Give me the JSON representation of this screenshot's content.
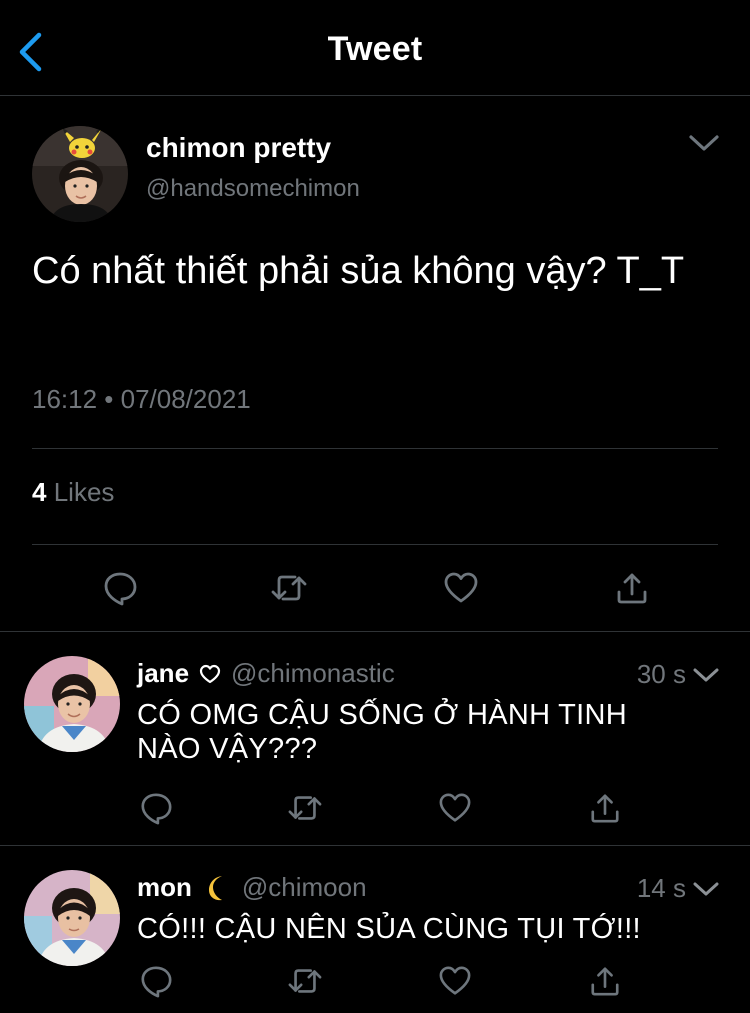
{
  "header": {
    "title": "Tweet"
  },
  "tweet": {
    "author_name": "chimon pretty",
    "author_handle": "@handsomechimon",
    "text": "Có nhất thiết phải sủa không vậy? T_T",
    "timestamp": "16:12 • 07/08/2021",
    "likes_count": "4",
    "likes_label": "Likes"
  },
  "replies": [
    {
      "name": "jane",
      "name_glyph": "heart-outline-icon",
      "handle": "@chimonastic",
      "time": "30 s",
      "text": "CÓ OMG CẬU SỐNG Ở HÀNH TINH NÀO VẬY???"
    },
    {
      "name": "mon",
      "name_glyph": "crescent-moon-emoji",
      "handle": "@chimoon",
      "time": "14 s",
      "text": "CÓ!!! CẬU NÊN SỦA CÙNG TỤI TỚ!!!"
    }
  ],
  "colors": {
    "background": "#000000",
    "accent_blue": "#1d9bf0",
    "secondary_text": "#71767b",
    "divider": "#2f3336",
    "icon": "#6e767d"
  }
}
